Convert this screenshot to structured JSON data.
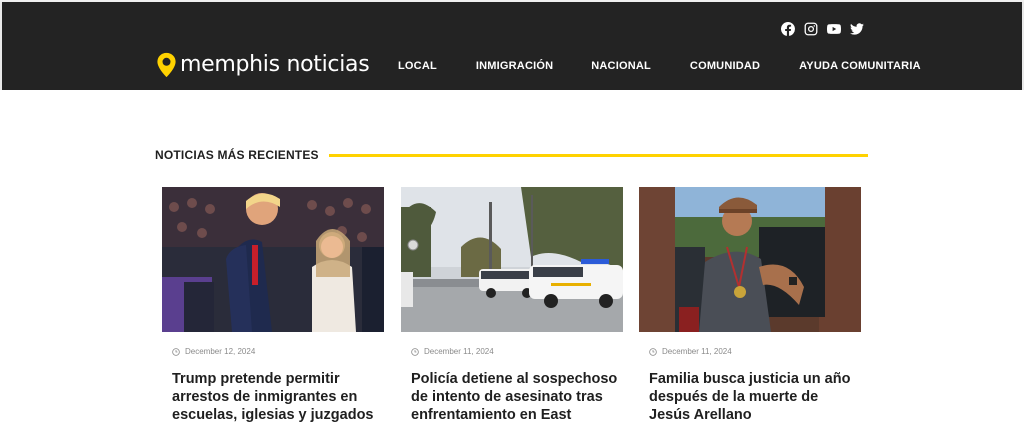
{
  "brand": {
    "name": "memphis noticias",
    "accent": "#ffd200",
    "header_bg": "#232323"
  },
  "social": [
    {
      "icon": "facebook-icon"
    },
    {
      "icon": "instagram-icon"
    },
    {
      "icon": "youtube-icon"
    },
    {
      "icon": "twitter-icon"
    }
  ],
  "nav": {
    "items": [
      {
        "label": "LOCAL"
      },
      {
        "label": "INMIGRACIÓN"
      },
      {
        "label": "NACIONAL"
      },
      {
        "label": "COMUNIDAD"
      },
      {
        "label": "AYUDA COMUNITARIA"
      }
    ]
  },
  "section": {
    "title": "NOTICIAS MÁS RECIENTES"
  },
  "articles": [
    {
      "date": "December 12, 2024",
      "title": "Trump pretende permitir arrestos de inmigrantes en escuelas, iglesias y juzgados"
    },
    {
      "date": "December 11, 2024",
      "title": "Policía detiene al sospechoso de intento de asesinato tras enfrentamiento en East"
    },
    {
      "date": "December 11, 2024",
      "title": "Familia busca justicia un año después de la muerte de Jesús Arellano"
    }
  ]
}
